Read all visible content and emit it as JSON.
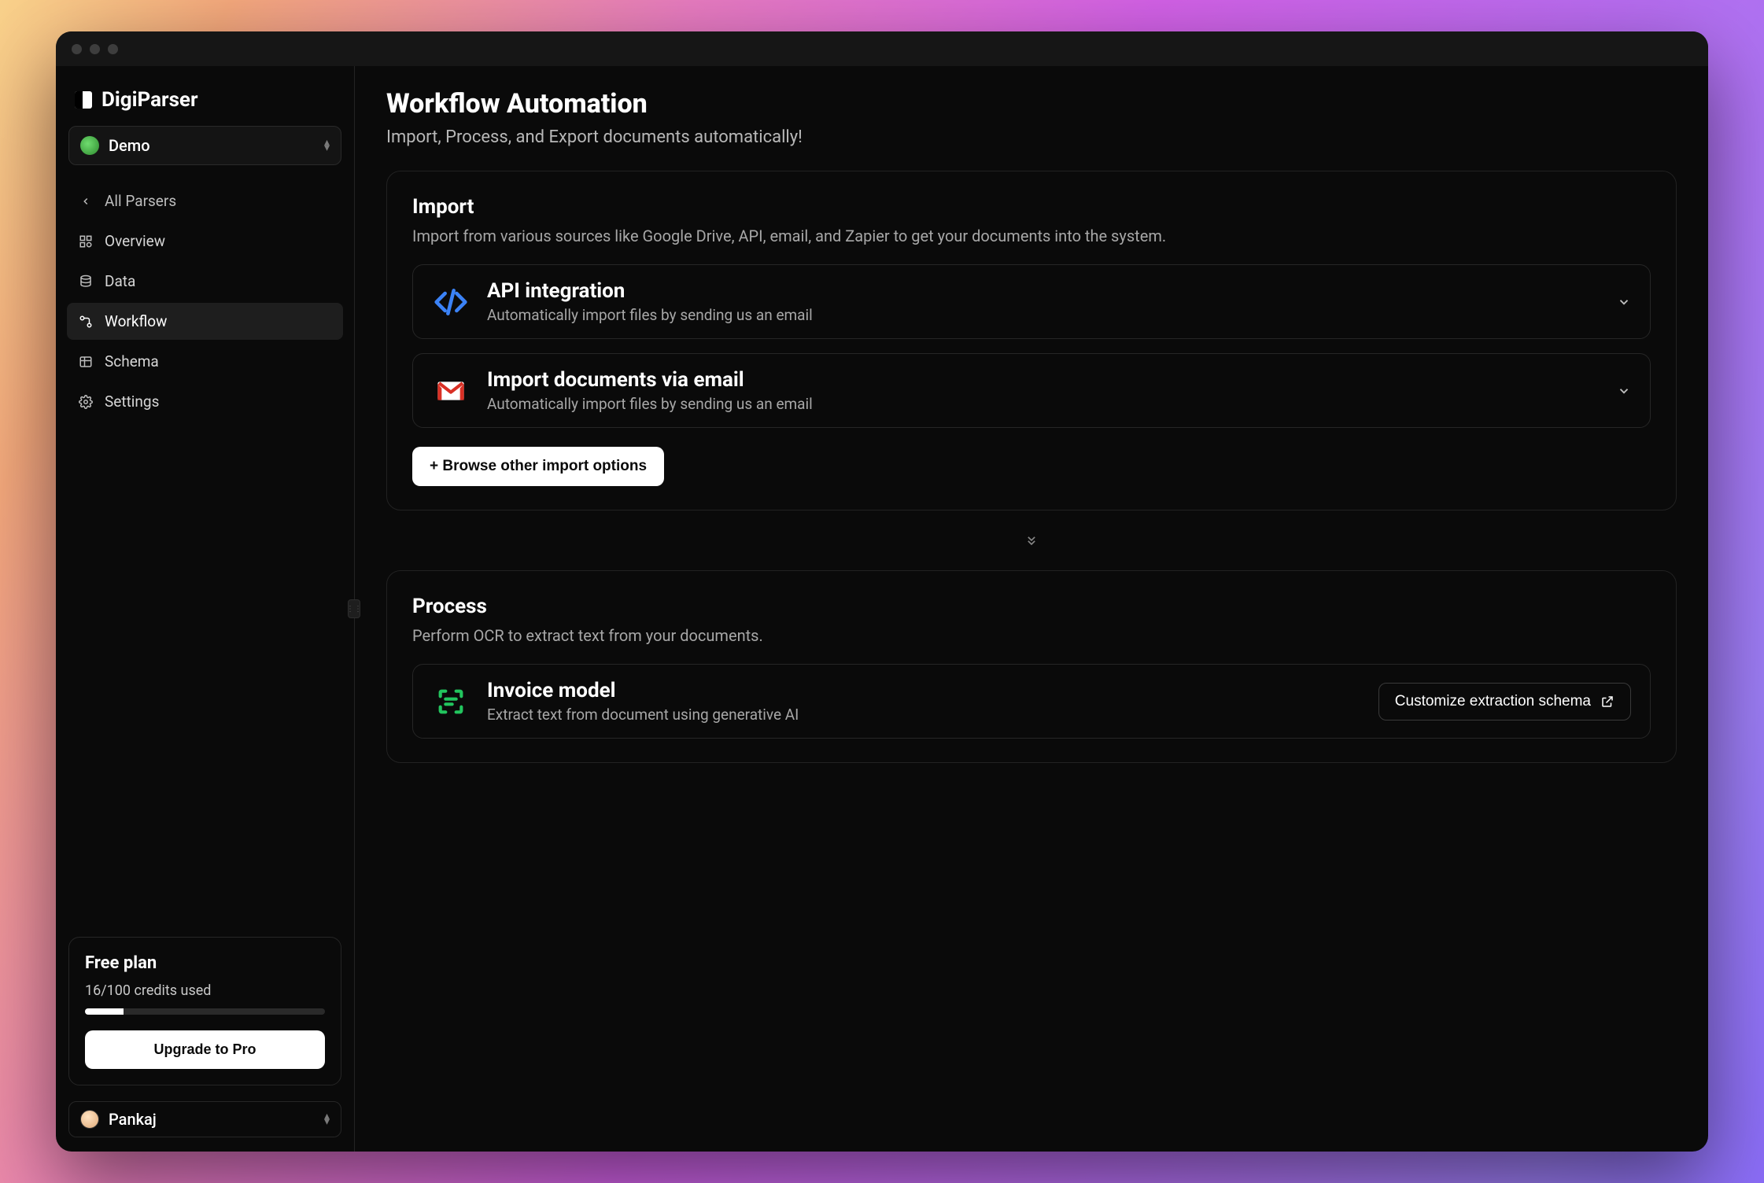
{
  "brand": {
    "name": "DigiParser"
  },
  "org_selector": {
    "label": "Demo"
  },
  "nav": {
    "back": "All Parsers",
    "items": [
      {
        "label": "Overview"
      },
      {
        "label": "Data"
      },
      {
        "label": "Workflow"
      },
      {
        "label": "Schema"
      },
      {
        "label": "Settings"
      }
    ]
  },
  "plan": {
    "title": "Free plan",
    "usage": "16/100 credits used",
    "upgrade_label": "Upgrade to Pro"
  },
  "user_selector": {
    "label": "Pankaj"
  },
  "page": {
    "title": "Workflow Automation",
    "subtitle": "Import, Process, and Export documents automatically!"
  },
  "import_panel": {
    "title": "Import",
    "subtitle": "Import from various sources like Google Drive, API, email, and Zapier to get your documents into the system.",
    "options": [
      {
        "title": "API integration",
        "subtitle": "Automatically import files by sending us an email"
      },
      {
        "title": "Import documents via email",
        "subtitle": "Automatically import files by sending us an email"
      }
    ],
    "browse_label": "+ Browse other import options"
  },
  "process_panel": {
    "title": "Process",
    "subtitle": "Perform OCR to extract text from your documents.",
    "model": {
      "title": "Invoice model",
      "subtitle": "Extract text from document using generative AI"
    },
    "customize_label": "Customize extraction schema"
  }
}
